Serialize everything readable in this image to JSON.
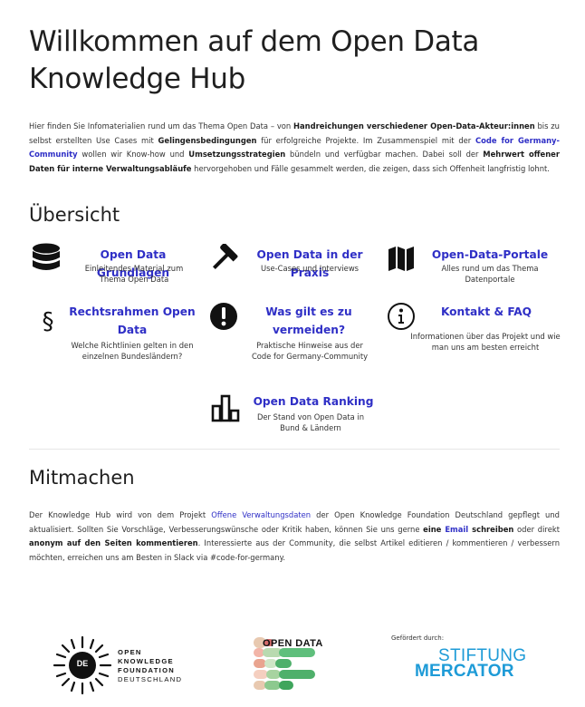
{
  "page": {
    "title": "Willkommen auf dem Open Data Knowledge Hub"
  },
  "intro": {
    "t1": "Hier finden Sie Infomaterialien rund um das Thema Open Data – von ",
    "b1": "Handreichungen verschiedener Open-Data-Akteur:innen",
    "t2": " bis zu selbst erstellten Use Cases mit ",
    "b2": "Gelingensbedingungen",
    "t3": " für erfolgreiche Projekte. Im Zusammenspiel mit der ",
    "link": "Code for Germany-Community",
    "t4": " wollen wir Know-how und ",
    "b3": "Umsetzungsstrategien",
    "t5": " bündeln und verfügbar machen. Dabei soll der ",
    "b4": "Mehrwert offener Daten für interne Verwaltungsabläufe",
    "t6": " hervorgehoben und Fälle gesammelt werden, die zeigen, dass sich Offenheit langfristig lohnt."
  },
  "overview": {
    "heading": "Übersicht",
    "tiles": [
      {
        "title": "Open Data Grundlagen",
        "desc": "Einleitendes Material zum Thema Open Data",
        "icon": "database-icon"
      },
      {
        "title": "Open Data in der Praxis",
        "desc": "Use-Cases und Interviews",
        "icon": "hammer-icon"
      },
      {
        "title": "Open-Data-Portale",
        "desc": "Alles rund um das Thema Datenportale",
        "icon": "map-icon"
      },
      {
        "title": "Rechtsrahmen Open Data",
        "desc": "Welche Richtlinien gelten in den einzelnen Bundesländern?",
        "icon": "paragraph-icon",
        "glyph": "§"
      },
      {
        "title": "Was gilt es zu vermeiden?",
        "desc": "Praktische Hinweise aus der Code for Germany-Community",
        "icon": "exclamation-icon",
        "glyph": "!"
      },
      {
        "title": "Kontakt & FAQ",
        "desc": "Informationen über das Projekt und wie man uns am besten erreicht",
        "icon": "info-icon",
        "glyph": "i"
      },
      {
        "title": "Open Data Ranking",
        "desc": "Der Stand von Open Data in Bund & Ländern",
        "icon": "bar-chart-icon"
      }
    ]
  },
  "mitmachen": {
    "heading": "Mitmachen",
    "t1": "Der Knowledge Hub wird von dem Projekt ",
    "link1": "Offene Verwaltungsdaten",
    "t2": " der Open Knowledge Foundation Deutschland gepflegt und aktualisiert. Sollten Sie Vorschläge, Verbesserungswünsche oder Kritik haben, können Sie uns gerne ",
    "b1": "eine ",
    "link2": "Email",
    "b2": " schreiben",
    "t3": " oder direkt ",
    "b3": "anonym auf den Seiten kommentieren",
    "t4": ". Interessierte aus der Community, die selbst Artikel editieren / kommentieren / verbessern möchten, erreichen uns am Besten in Slack via #code-for-germany."
  },
  "footer": {
    "okf": {
      "badge": "DE",
      "lines": [
        "OPEN",
        "KNOWLEDGE",
        "FOUNDATION",
        "DEUTSCHLAND"
      ]
    },
    "opendata": {
      "text": "OPEN DATA"
    },
    "mercator": {
      "label": "Gefördert durch:",
      "line1": "STIFTUNG",
      "line2": "MERCATOR"
    }
  },
  "colors": {
    "link": "#2f2fc6",
    "text": "#333333",
    "heading": "#1f1f1f",
    "mercator": "#1e9bd7"
  }
}
